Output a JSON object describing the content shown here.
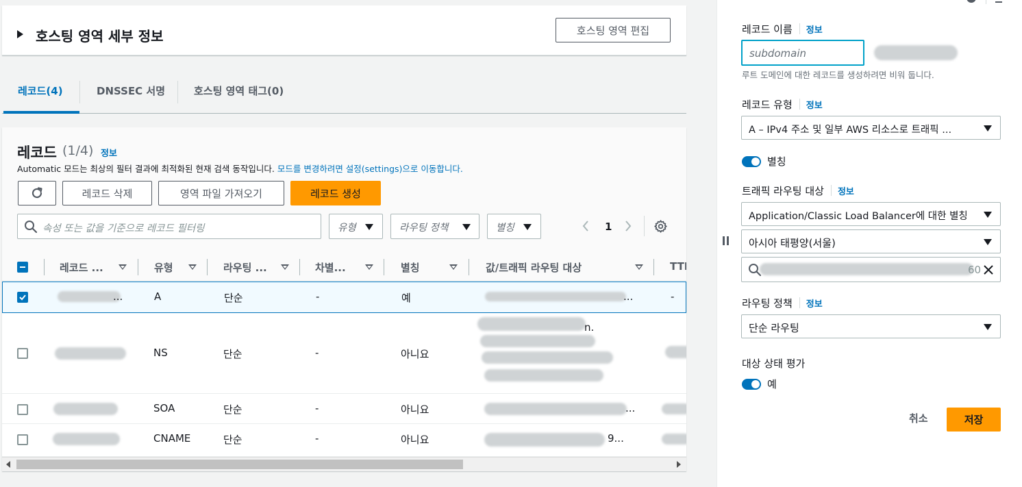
{
  "hosted_zone": {
    "title": "호스팅 영역 세부 정보",
    "edit_button": "호스팅 영역 편집"
  },
  "tabs": [
    {
      "label": "레코드(4)",
      "active": true
    },
    {
      "label": "DNSSEC 서명",
      "active": false
    },
    {
      "label": "호스팅 영역 태그(0)",
      "active": false
    }
  ],
  "records": {
    "title": "레코드",
    "count": "(1/4)",
    "info": "정보",
    "description_prefix": "Automatic 모드는 최상의 필터 결과에 최적화된 현재 검색 동작입니다.",
    "description_link": "모드를 변경하려면 설정(settings)으로 이동합니다.",
    "refresh_icon": "refresh-icon",
    "buttons": {
      "delete": "레코드 삭제",
      "import": "영역 파일 가져오기",
      "create": "레코드 생성"
    },
    "search_placeholder": "속성 또는 값을 기준으로 레코드 필터링",
    "filters": {
      "type": "유형",
      "routing_policy": "라우팅 정책",
      "alias": "별칭"
    },
    "pagination": {
      "page": "1"
    },
    "columns": [
      "레코드 ...",
      "유형",
      "라우팅 ...",
      "차별...",
      "별칭",
      "값/트래픽 라우팅 대상",
      "TTL"
    ],
    "rows": [
      {
        "name": "...",
        "type": "A",
        "routing": "단순",
        "diff": "-",
        "alias": "예",
        "value": "...",
        "ttl": "-",
        "selected": true
      },
      {
        "name": "...",
        "type": "NS",
        "routing": "단순",
        "diff": "-",
        "alias": "아니요",
        "value": "n.",
        "ttl": "",
        "selected": false
      },
      {
        "name": "...",
        "type": "SOA",
        "routing": "단순",
        "diff": "-",
        "alias": "아니요",
        "value": "...",
        "ttl": "",
        "selected": false
      },
      {
        "name": "...",
        "type": "CNAME",
        "routing": "단순",
        "diff": "-",
        "alias": "아니요",
        "value": "9...",
        "ttl": "",
        "selected": false
      }
    ]
  },
  "side_panel": {
    "record_name_label": "레코드 이름",
    "record_name_info": "정보",
    "record_name_placeholder": "subdomain",
    "record_name_hint": "루트 도메인에 대한 레코드를 생성하려면 비워 둡니다.",
    "record_type_label": "레코드 유형",
    "record_type_info": "정보",
    "record_type_value": "A – IPv4 주소 및 일부 AWS 리소스로 트래픽 ...",
    "alias_label": "별칭",
    "alias_on": true,
    "traffic_target_label": "트래픽 라우팅 대상",
    "traffic_target_info": "정보",
    "traffic_target_value": "Application/Classic Load Balancer에 대한 별칭",
    "region_value": "아시아 태평양(서울)",
    "lb_search_value": "60",
    "routing_policy_label": "라우팅 정책",
    "routing_policy_info": "정보",
    "routing_policy_value": "단순 라우팅",
    "health_eval_label": "대상 상태 평가",
    "health_eval_value": "예",
    "health_eval_on": true,
    "cancel": "취소",
    "save": "저장"
  },
  "colors": {
    "primary": "#ff9900",
    "link": "#0073bb",
    "toggle": "#0073bb"
  }
}
